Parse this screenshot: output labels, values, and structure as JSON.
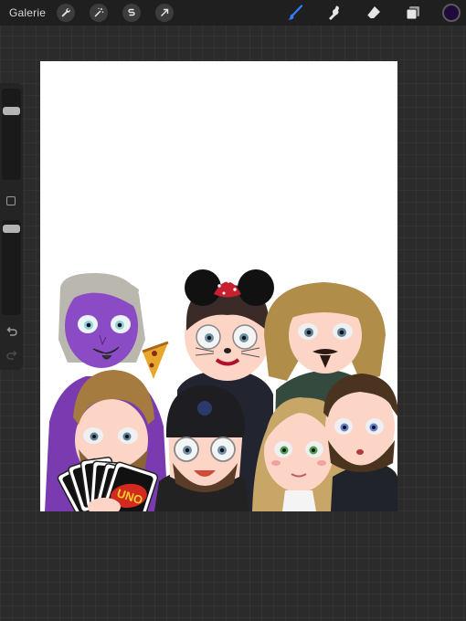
{
  "toolbar": {
    "gallery_label": "Galerie",
    "left_tools": [
      "wrench-icon",
      "magic-wand-icon",
      "selection-s-icon",
      "transform-arrow-icon"
    ],
    "right_tools": [
      "brush-icon",
      "smudge-icon",
      "eraser-icon",
      "layers-icon"
    ],
    "active_tool": "brush",
    "current_color": "#1f0a3a"
  },
  "sidebar": {
    "size_slider_level": 0.1,
    "opacity_slider_level": 0.05
  },
  "colors": {
    "active_accent": "#2f7fff",
    "canvas_bg": "#ffffff"
  },
  "artwork": {
    "card_text": "UNO"
  }
}
